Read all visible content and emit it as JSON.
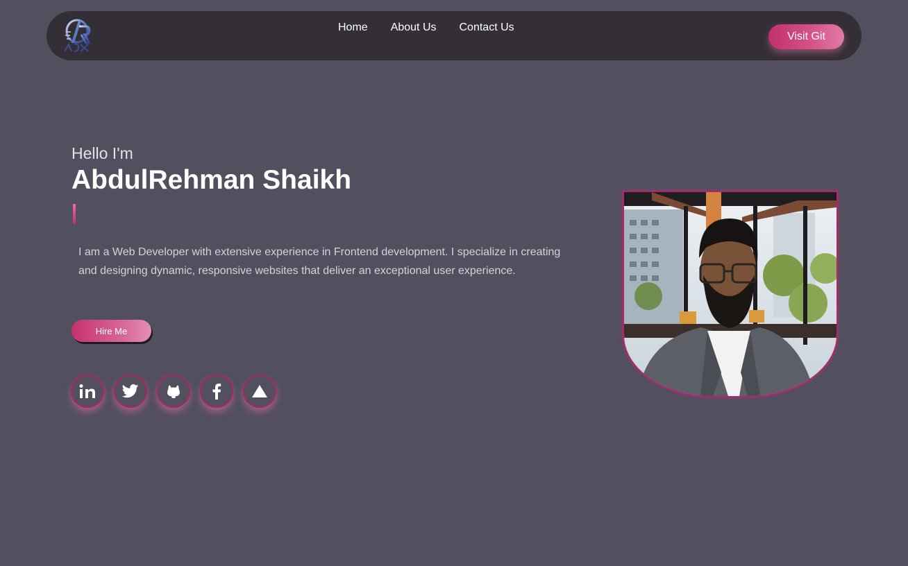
{
  "navbar": {
    "links": [
      "Home",
      "About Us",
      "Contact Us"
    ],
    "git_label": "Visit Git"
  },
  "hero": {
    "greeting": "Hello I'm",
    "name": "AbdulRehman Shaikh",
    "bio": "I am a Web Developer with extensive experience in Frontend development. I specialize in creating and designing dynamic, responsive websites that deliver an exceptional user experience.",
    "hire_label": "Hire Me"
  },
  "socials": [
    {
      "icon": "linkedin-icon"
    },
    {
      "icon": "twitter-icon"
    },
    {
      "icon": "github-icon"
    },
    {
      "icon": "facebook-icon"
    },
    {
      "icon": "triangle-up-icon"
    }
  ],
  "colors": {
    "background": "#52505f",
    "navbar": "#342f36",
    "accent": "#c2306d",
    "accent_light": "#e07ba5",
    "ring": "#a52763"
  }
}
